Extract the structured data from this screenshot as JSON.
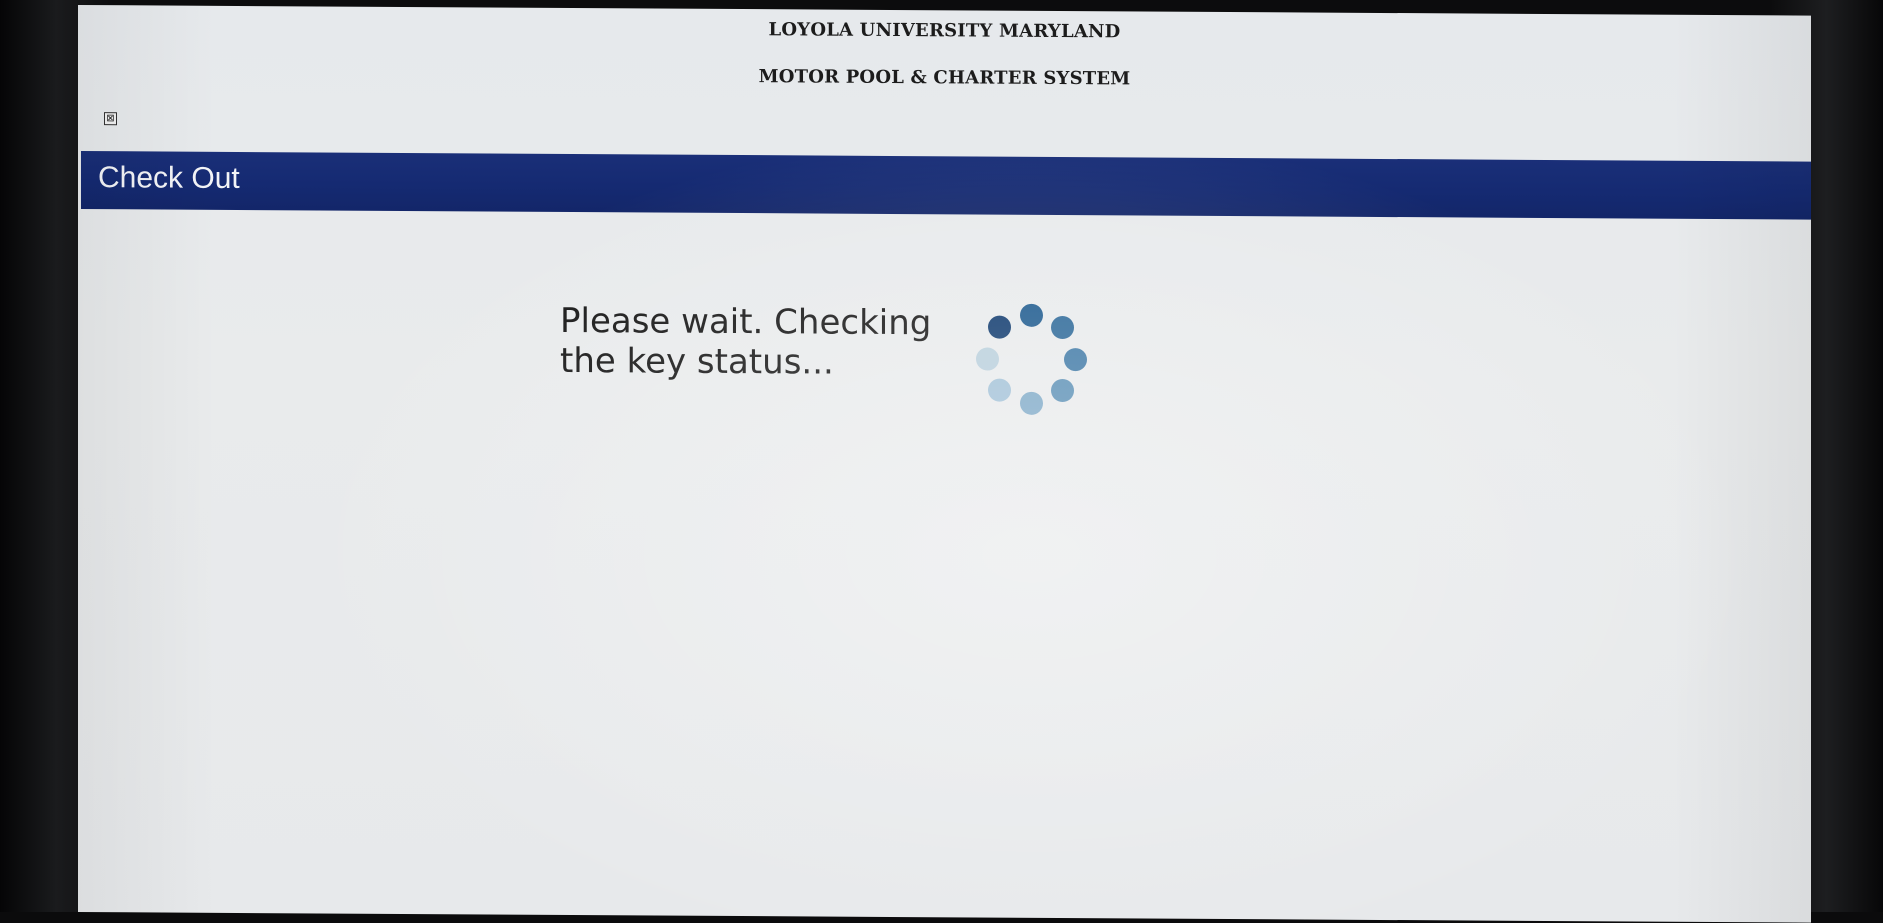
{
  "header": {
    "institution": "LOYOLA UNIVERSITY MARYLAND",
    "system_name": "MOTOR POOL & CHARTER SYSTEM"
  },
  "toolbar": {
    "close_glyph": "⊠",
    "close_icon": "close-box-icon"
  },
  "page": {
    "title": "Check Out"
  },
  "status": {
    "line1": "Please wait. Checking",
    "line2": "the key status..."
  },
  "spinner": {
    "icon": "loading-spinner-icon",
    "dot_colors": [
      "#1d5a8e",
      "#2c6898",
      "#3f79a6",
      "#5a8fb5",
      "#7ea9c7",
      "#a2c1d7",
      "#b9cfdc",
      "#0f3a6e"
    ]
  },
  "colors": {
    "title_bar": "#152a72",
    "title_text": "#f3f4f7",
    "screen_bg": "#e8eaec"
  }
}
